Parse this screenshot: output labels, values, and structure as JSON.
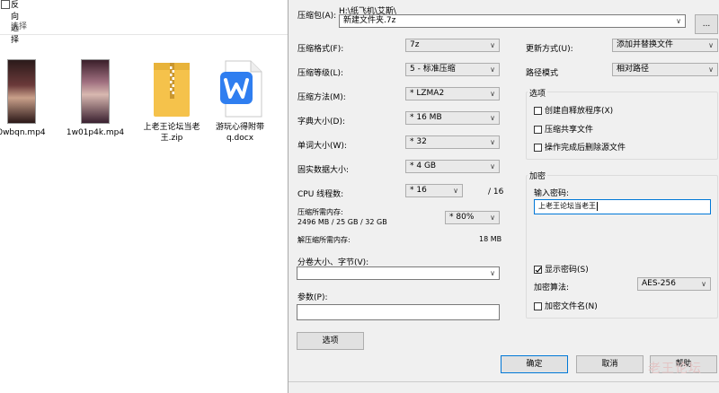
{
  "explorer": {
    "ribbon": {
      "invert_selection": "反向选择",
      "group_label": "选择"
    },
    "files": [
      {
        "name": "0wbqn.mp4",
        "icon": "video-thumbnail-icon"
      },
      {
        "name": "1w01p4k.mp4",
        "icon": "video-thumbnail-icon"
      },
      {
        "name": "上老王论坛当老王.zip",
        "icon": "zip-folder-icon"
      },
      {
        "name": "游玩心得附带q.docx",
        "icon": "wps-doc-icon"
      }
    ]
  },
  "dialog": {
    "archive_label": "压缩包(A):",
    "archive_path": "H:\\纸飞机\\艾斯\\",
    "archive_name": "新建文件夹.7z",
    "browse_label": "...",
    "format": {
      "label": "压缩格式(F):",
      "value": "7z"
    },
    "level": {
      "label": "压缩等级(L):",
      "value": "5 - 标准压缩"
    },
    "method": {
      "label": "压缩方法(M):",
      "value": "* LZMA2"
    },
    "dict": {
      "label": "字典大小(D):",
      "value": "* 16 MB"
    },
    "word": {
      "label": "单词大小(W):",
      "value": "* 32"
    },
    "solid": {
      "label": "固实数据大小:",
      "value": "* 4 GB"
    },
    "cpu": {
      "label": "CPU 线程数:",
      "value": "* 16",
      "total": "/ 16"
    },
    "mem_compress": {
      "label": "压缩所需内存:",
      "detail": "2496 MB / 25 GB / 32 GB",
      "value": "* 80%"
    },
    "mem_decompress": {
      "label": "解压缩所需内存:",
      "value": "18 MB"
    },
    "split": {
      "label": "分卷大小、字节(V):",
      "value": ""
    },
    "params": {
      "label": "参数(P):",
      "value": ""
    },
    "options_button": "选项",
    "update": {
      "label": "更新方式(U):",
      "value": "添加并替换文件"
    },
    "path_mode": {
      "label": "路径模式",
      "value": "相对路径"
    },
    "options_group": {
      "title": "选项",
      "sfx": "创建自释放程序(X)",
      "shared": "压缩共享文件",
      "delete": "操作完成后删除源文件"
    },
    "encryption": {
      "title": "加密",
      "password_label": "输入密码:",
      "password_value": "上老王论坛当老王",
      "show_password": "显示密码(S)",
      "method_label": "加密算法:",
      "method_value": "AES-256",
      "encrypt_names": "加密文件名(N)"
    },
    "ok": "确定",
    "cancel": "取消",
    "help": "帮助",
    "watermark": "老王论坛"
  }
}
